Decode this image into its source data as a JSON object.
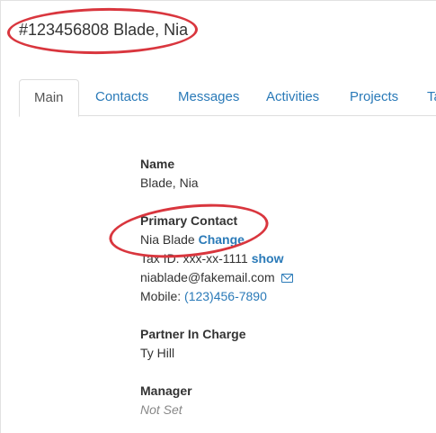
{
  "record": {
    "title": "#123456808 Blade, Nia"
  },
  "tabs": [
    {
      "label": "Main",
      "active": true
    },
    {
      "label": "Contacts"
    },
    {
      "label": "Messages"
    },
    {
      "label": "Activities"
    },
    {
      "label": "Projects"
    },
    {
      "label": "Ta"
    }
  ],
  "details": {
    "name": {
      "label": "Name",
      "value": "Blade, Nia"
    },
    "primary_contact": {
      "label": "Primary Contact",
      "value": "Nia Blade",
      "change_label": "Change",
      "tax_id_text": "Tax ID: xxx-xx-1111",
      "show_label": "show",
      "email": "niablade@fakemail.com",
      "mobile_label": "Mobile:",
      "mobile_value": "(123)456-7890"
    },
    "partner_in_charge": {
      "label": "Partner In Charge",
      "value": "Ty Hill"
    },
    "manager": {
      "label": "Manager",
      "value": "Not Set"
    }
  },
  "colors": {
    "link": "#2a7ab8",
    "annotation": "#d9363e"
  },
  "icons": {
    "email": "envelope-icon"
  }
}
